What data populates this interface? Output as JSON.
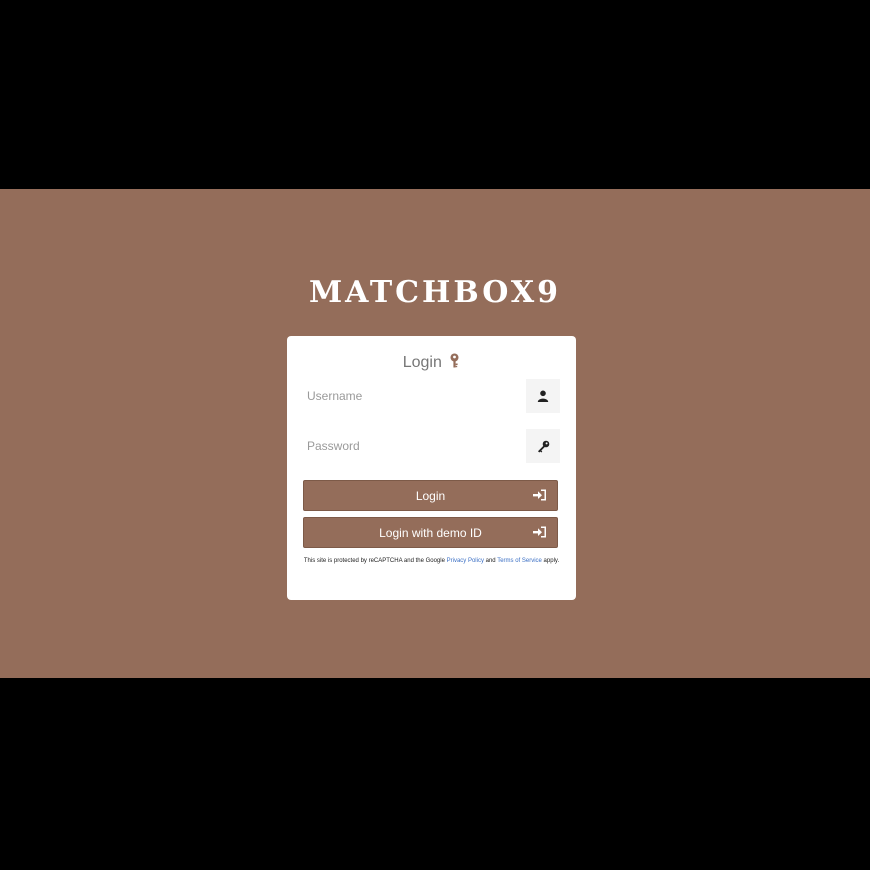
{
  "brand": {
    "logo_text": "MATCHBOX9"
  },
  "login_card": {
    "title": "Login",
    "title_icon": "key-icon",
    "username": {
      "placeholder": "Username",
      "value": "",
      "icon": "user-icon"
    },
    "password": {
      "placeholder": "Password",
      "value": "",
      "icon": "key-icon"
    },
    "login_button": {
      "label": "Login",
      "icon": "sign-in-icon"
    },
    "demo_button": {
      "label": "Login with demo ID",
      "icon": "sign-in-icon"
    },
    "recaptcha_notice": {
      "prefix": "This site is protected by reCAPTCHA and the Google ",
      "privacy_link": "Privacy Policy",
      "middle": " and ",
      "terms_link": "Terms of Service",
      "suffix": " apply."
    }
  },
  "colors": {
    "background": "#946d5a",
    "button": "#946d5a",
    "letterbox": "#000000",
    "card": "#ffffff",
    "link": "#3b6fc4"
  }
}
